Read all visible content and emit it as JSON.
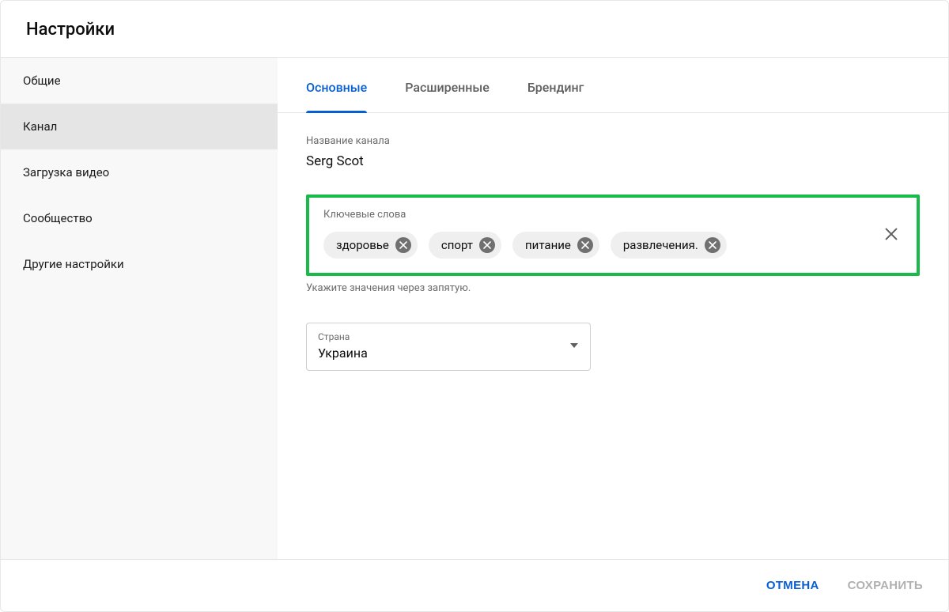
{
  "header": {
    "title": "Настройки"
  },
  "sidebar": {
    "items": [
      {
        "label": "Общие"
      },
      {
        "label": "Канал"
      },
      {
        "label": "Загрузка видео"
      },
      {
        "label": "Сообщество"
      },
      {
        "label": "Другие настройки"
      }
    ],
    "active_index": 1
  },
  "tabs": {
    "items": [
      {
        "label": "Основные"
      },
      {
        "label": "Расширенные"
      },
      {
        "label": "Брендинг"
      }
    ],
    "active_index": 0
  },
  "channel": {
    "name_label": "Название канала",
    "name_value": "Serg Scot"
  },
  "keywords": {
    "label": "Ключевые слова",
    "chips": [
      {
        "label": "здоровье"
      },
      {
        "label": "спорт"
      },
      {
        "label": "питание"
      },
      {
        "label": "развлечения."
      }
    ],
    "helper": "Укажите значения через запятую."
  },
  "country": {
    "label": "Страна",
    "value": "Украина"
  },
  "footer": {
    "cancel": "ОТМЕНА",
    "save": "СОХРАНИТЬ"
  }
}
